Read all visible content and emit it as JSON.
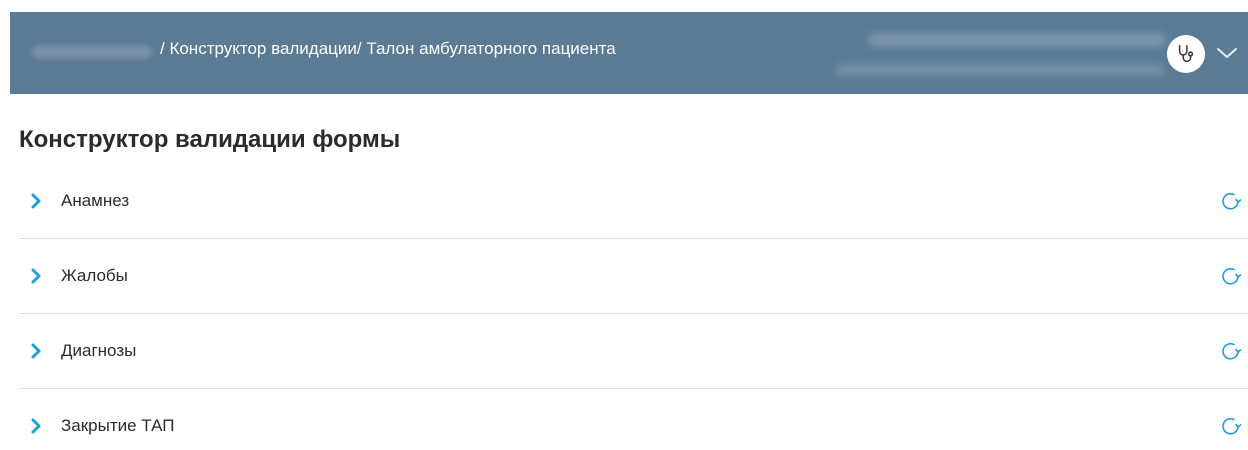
{
  "header": {
    "breadcrumb": "/ Конструктор валидации/ Талон амбулаторного пациента",
    "avatar_icon": "stethoscope-icon",
    "menu_icon": "chevron-down-icon",
    "background_color": "#5b7a94"
  },
  "main": {
    "title": "Конструктор валидации формы",
    "sections": [
      {
        "label": "Анамнез",
        "expand_icon": "chevron-right-icon",
        "action_icon": "refresh-icon"
      },
      {
        "label": "Жалобы",
        "expand_icon": "chevron-right-icon",
        "action_icon": "refresh-icon"
      },
      {
        "label": "Диагнозы",
        "expand_icon": "chevron-right-icon",
        "action_icon": "refresh-icon"
      },
      {
        "label": "Закрытие ТАП",
        "expand_icon": "chevron-right-icon",
        "action_icon": "refresh-icon"
      }
    ]
  },
  "colors": {
    "accent": "#1ba0d8",
    "divider": "#e0e0e0",
    "text": "#2b2b2b"
  }
}
